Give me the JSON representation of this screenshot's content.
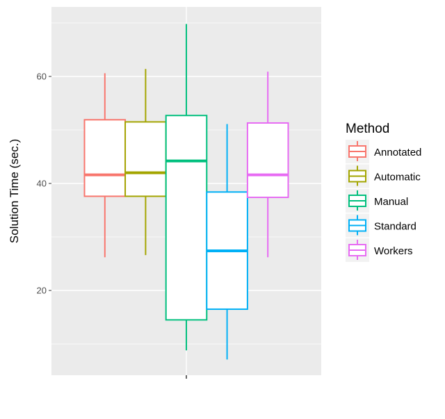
{
  "chart_data": {
    "type": "boxplot",
    "title": "",
    "xlabel": "",
    "ylabel": "Solution Time (sec.)",
    "ylim": [
      4,
      73
    ],
    "yticks": [
      20,
      40,
      60
    ],
    "yminor": [
      10,
      30,
      50,
      70
    ],
    "x_categories": [
      ""
    ],
    "grid": true,
    "legend": {
      "title": "Method",
      "placement": "right"
    },
    "series": [
      {
        "name": "Annotated",
        "color": "#F8766D",
        "whisker_low": 26.2,
        "q1": 37.6,
        "median": 41.6,
        "q3": 51.9,
        "whisker_high": 60.6
      },
      {
        "name": "Automatic",
        "color": "#A3A500",
        "whisker_low": 26.6,
        "q1": 37.6,
        "median": 42.0,
        "q3": 51.5,
        "whisker_high": 61.4
      },
      {
        "name": "Manual",
        "color": "#00BF7D",
        "whisker_low": 8.8,
        "q1": 14.5,
        "median": 44.2,
        "q3": 52.7,
        "whisker_high": 69.8
      },
      {
        "name": "Standard",
        "color": "#00B0F6",
        "whisker_low": 7.1,
        "q1": 16.5,
        "median": 27.4,
        "q3": 38.4,
        "whisker_high": 51.1
      },
      {
        "name": "Workers",
        "color": "#E76BF3",
        "whisker_low": 26.2,
        "q1": 37.4,
        "median": 41.6,
        "q3": 51.3,
        "whisker_high": 60.9
      }
    ]
  }
}
